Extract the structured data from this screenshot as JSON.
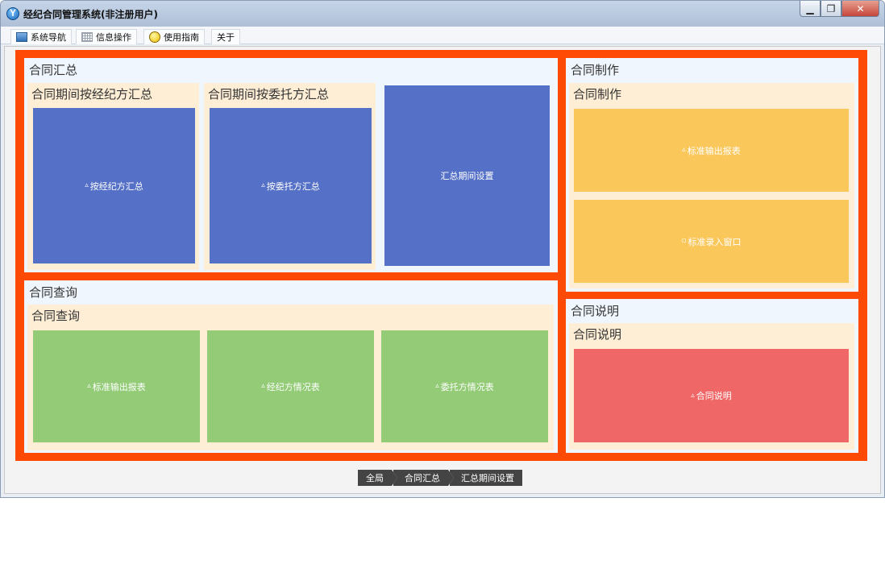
{
  "window": {
    "title": "经纪合同管理系统(非注册用户)",
    "controls": {
      "minimize": "▁",
      "maximize": "❐",
      "close": "✕"
    }
  },
  "menu": [
    {
      "label": "系统导航",
      "icon": "monitor-icon"
    },
    {
      "label": "信息操作",
      "icon": "grid-icon"
    },
    {
      "label": "使用指南",
      "icon": "bulb-icon"
    },
    {
      "label": "关于",
      "icon": ""
    }
  ],
  "panels": {
    "summary": {
      "title": "合同汇总",
      "group_agent": {
        "title": "合同期间按经纪方汇总",
        "tile": "按经纪方汇总"
      },
      "group_client": {
        "title": "合同期间按委托方汇总",
        "tile": "按委托方汇总"
      },
      "tile_period": "汇总期间设置"
    },
    "production": {
      "title": "合同制作",
      "group": {
        "title": "合同制作",
        "tiles": [
          "标准输出报表",
          "标准录入窗口"
        ]
      }
    },
    "query": {
      "title": "合同查询",
      "group": {
        "title": "合同查询",
        "tiles": [
          "标准输出报表",
          "经纪方情况表",
          "委托方情况表"
        ]
      }
    },
    "description": {
      "title": "合同说明",
      "group": {
        "title": "合同说明",
        "tiles": [
          "合同说明"
        ]
      }
    }
  },
  "tile_icons": {
    "report": "▵",
    "window": "▫"
  },
  "breadcrumb": [
    "全局",
    "合同汇总",
    "汇总期间设置"
  ],
  "colors": {
    "frame": "#ff4a06",
    "blue_tile": "#5570c7",
    "yellow_tile": "#fac75b",
    "green_tile": "#93cb76",
    "red_tile": "#ef6767",
    "panel_bg": "#eff6fd",
    "group_bg": "#feeed6"
  }
}
